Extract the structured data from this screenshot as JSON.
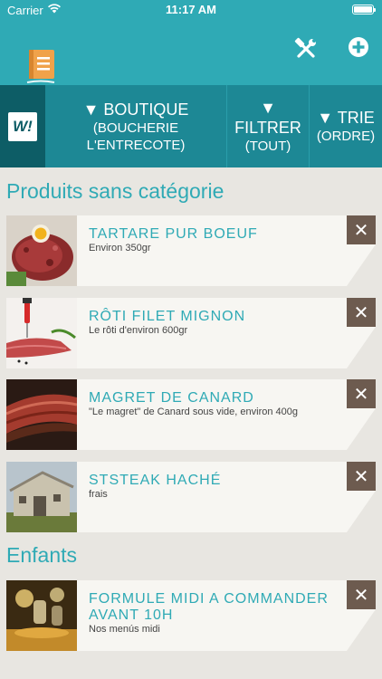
{
  "status_bar": {
    "carrier": "Carrier",
    "time": "11:17 AM"
  },
  "header": {
    "tools_icon": "tools-icon",
    "add_icon": "plus-circle-icon",
    "logo_icon": "book-icon"
  },
  "tabs": {
    "logo": "W!",
    "boutique": {
      "label": "▼ BOUTIQUE",
      "line1": "(BOUCHERIE",
      "line2": "L'ENTRECOTE)"
    },
    "filtrer": {
      "label": "▼",
      "label2": "FILTRER",
      "value": "(TOUT)"
    },
    "trie": {
      "label": "▼ TRIE",
      "value": "(ORDRE)"
    }
  },
  "sections": [
    {
      "title": "Produits sans catégorie",
      "items": [
        {
          "name": "TARTARE PUR BOEUF",
          "desc": "Environ 350gr"
        },
        {
          "name": "RÔTI FILET MIGNON",
          "desc": "Le rôti d'environ 600gr"
        },
        {
          "name": "MAGRET DE CANARD",
          "desc": "\"Le magret\" de Canard sous vide, environ 400g"
        },
        {
          "name": "STSTEAK HACHÉ",
          "desc": "frais"
        }
      ]
    },
    {
      "title": "Enfants",
      "items": [
        {
          "name": "FORMULE MIDI A COMMANDER AVANT 10H",
          "desc": "Nos menús midi"
        }
      ]
    }
  ],
  "delete_glyph": "✕",
  "colors": {
    "teal": "#2faab5",
    "dark_teal": "#1d8895",
    "darker_teal": "#0d5d66",
    "delete_brown": "#6d5b4f",
    "background": "#e8e6e1"
  }
}
